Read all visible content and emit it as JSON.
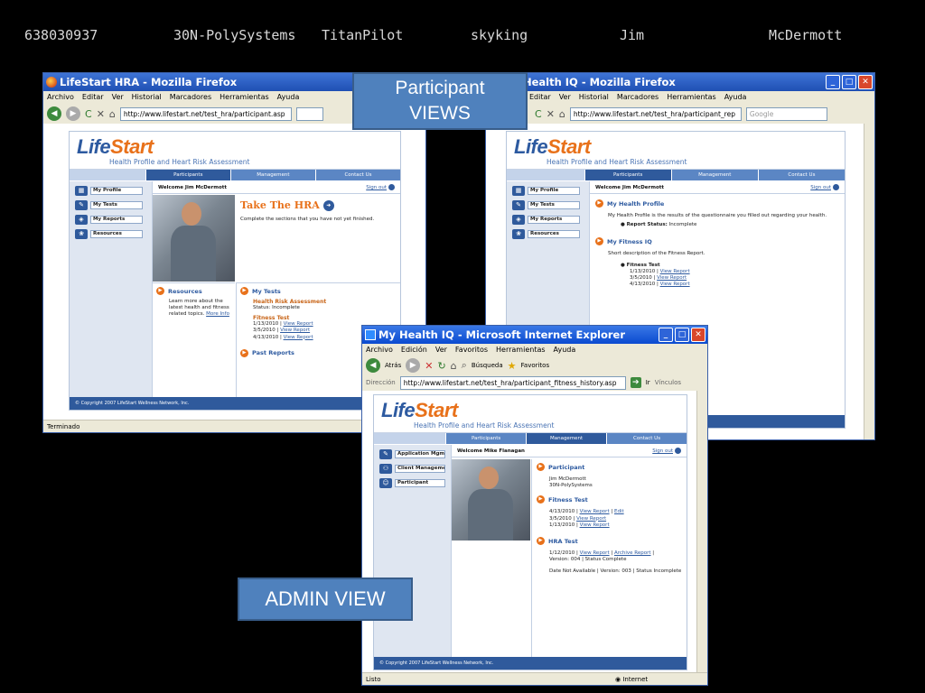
{
  "header": {
    "id": "638030937",
    "company": "30N-PolySystems",
    "product": "TitanPilot",
    "username": "skyking",
    "first_name": "Jim",
    "last_name": "McDermott"
  },
  "callouts": {
    "participant": "Participant VIEWS",
    "admin": "ADMIN VIEW"
  },
  "win1": {
    "title": "LifeStart HRA - Mozilla Firefox",
    "menu": [
      "Archivo",
      "Editar",
      "Ver",
      "Historial",
      "Marcadores",
      "Herramientas",
      "Ayuda"
    ],
    "url": "http://www.lifestart.net/test_hra/participant.asp",
    "status": "Terminado"
  },
  "win2": {
    "title": "My Health IQ - Mozilla Firefox",
    "menu": [
      "Editar",
      "Ver",
      "Historial",
      "Marcadores",
      "Herramientas",
      "Ayuda"
    ],
    "url": "http://www.lifestart.net/test_hra/participant_rep",
    "search_placeholder": "Google"
  },
  "win3": {
    "title": "My Health IQ - Microsoft Internet Explorer",
    "menu": [
      "Archivo",
      "Edición",
      "Ver",
      "Favoritos",
      "Herramientas",
      "Ayuda"
    ],
    "toolbar": {
      "back": "Atrás",
      "search": "Búsqueda",
      "favorites": "Favoritos"
    },
    "address_label": "Dirección",
    "url": "http://www.lifestart.net/test_hra/participant_fitness_history.asp",
    "go": "Ir",
    "links": "Vínculos",
    "status": "Listo",
    "zone": "Internet"
  },
  "site": {
    "logo_life": "Life",
    "logo_start": "Start",
    "tagline": "Health Profile and Heart Risk Assessment",
    "tabs": [
      "Participants",
      "Management",
      "Contact Us"
    ],
    "signout": "Sign out",
    "footer": "© Copyright 2007 LifeStart Wellness Network, Inc."
  },
  "participant_nav": [
    "My Profile",
    "My Tests",
    "My Reports",
    "Resources"
  ],
  "page1": {
    "welcome": "Welcome Jim McDermott",
    "take_hra": "Take The HRA",
    "take_hra_desc": "Complete the sections that you have not yet finished.",
    "resources_title": "Resources",
    "resources_desc": "Learn more about the latest health and fitness related topics.",
    "more_info": "More Info",
    "my_tests_title": "My Tests",
    "hra_title": "Health Risk Assessment",
    "hra_status": "Status: Incomplete",
    "fitness_title": "Fitness Test",
    "fitness_dates": [
      "1/13/2010",
      "3/5/2010",
      "4/13/2010"
    ],
    "view_report": "View Report",
    "past_reports": "Past Reports"
  },
  "page2": {
    "welcome": "Welcome Jim McDermott",
    "health_profile_title": "My Health Profile",
    "health_profile_desc": "My Health Profile is the results of the questionnaire you filled out regarding your health.",
    "report_status_label": "Report Status:",
    "report_status_value": "Incomplete",
    "fitness_iq_title": "My Fitness IQ",
    "fitness_iq_desc": "Short description of the Fitness Report.",
    "fitness_test": "Fitness Test",
    "fitness_dates": [
      "1/13/2010",
      "3/5/2010",
      "4/13/2010"
    ],
    "view_report": "View Report"
  },
  "page3": {
    "nav": [
      "Application Mgmt",
      "Client Management",
      "Participant"
    ],
    "welcome": "Welcome Mike Flanagan",
    "participant_title": "Participant",
    "participant_name": "Jim McDermott",
    "participant_company": "30N-PolySystems",
    "fitness_title": "Fitness Test",
    "fitness_dates": [
      "4/13/2010",
      "3/5/2010",
      "1/13/2010"
    ],
    "view_report": "View Report",
    "edit": "Edit",
    "hra_title": "HRA Test",
    "hra_line1_date": "1/12/2010",
    "archive_report": "Archive Report",
    "hra_line1_meta": "Version: 004  |  Status Complete",
    "hra_line2": "Date Not Available  |  Version: 003  |  Status Incomplete"
  }
}
